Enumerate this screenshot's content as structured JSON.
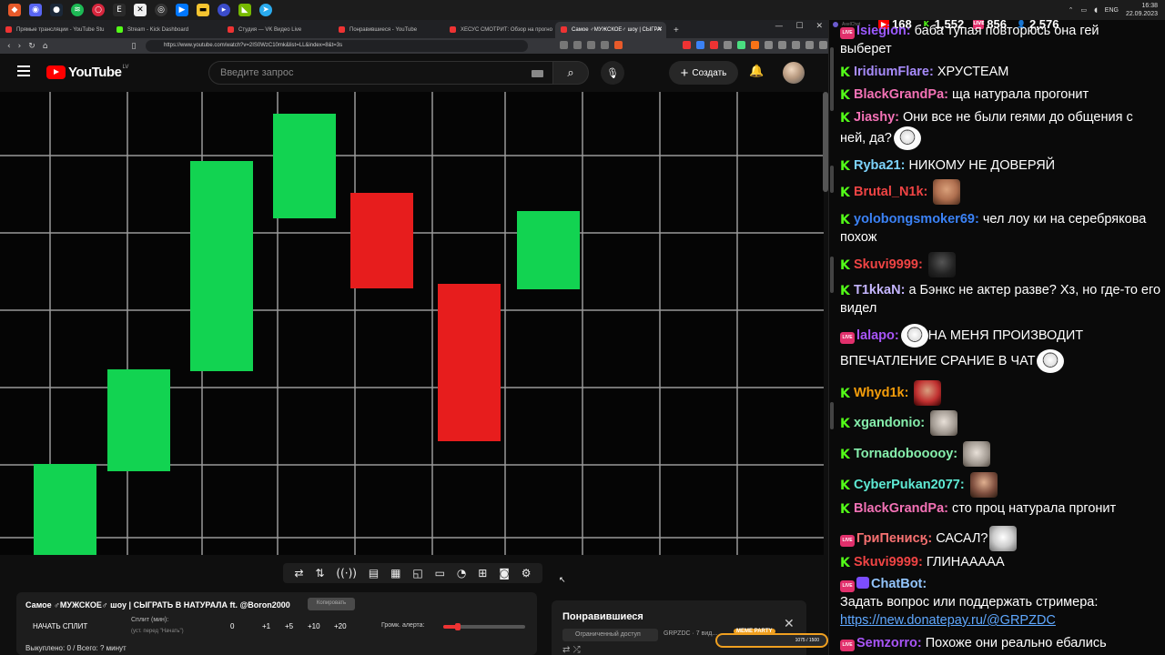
{
  "taskbar": {
    "icons": [
      "brave",
      "discord",
      "steam",
      "spotify",
      "opera-gx",
      "epic",
      "app-x",
      "obs",
      "vk",
      "folder",
      "youtube-music",
      "nvidia",
      "telegram"
    ],
    "tray_lang": "ENG",
    "clock_time": "16:38",
    "clock_date": "22.09.2023"
  },
  "browser": {
    "tabs": [
      {
        "label": "Прямые трансляции - YouTube Stu",
        "active": false
      },
      {
        "label": "Stream - Kick Dashboard",
        "active": false
      },
      {
        "label": "Студия — VK Видео Live",
        "active": false
      },
      {
        "label": "Понравившиеся - YouTube",
        "active": false
      },
      {
        "label": "ХЕСУС СМОТРИТ: Обзор на прогно",
        "active": false
      },
      {
        "label": "Самое ♂МУЖСКОЕ♂ шоу | СЫГРА",
        "active": true
      }
    ],
    "new_tab": "+",
    "url": "https://www.youtube.com/watch?v=2IS0WzC10mk&list=LL&index=8&t=3s"
  },
  "youtube": {
    "logo_text": "YouTube",
    "country": "LV",
    "search_placeholder": "Введите запрос",
    "create_label": "Создать"
  },
  "chart_data": {
    "type": "candlestick",
    "title": "",
    "xlabel": "",
    "ylabel": "",
    "bars": [
      {
        "open": 0,
        "close": 100,
        "direction": "up"
      },
      {
        "open": 92,
        "close": 204,
        "direction": "up"
      },
      {
        "open": 202,
        "close": 433,
        "direction": "up"
      },
      {
        "open": 370,
        "close": 485,
        "direction": "up"
      },
      {
        "open": 398,
        "close": 293,
        "direction": "down"
      },
      {
        "open": 298,
        "close": 125,
        "direction": "down"
      },
      {
        "open": 292,
        "close": 378,
        "direction": "up"
      }
    ],
    "ylim": [
      0,
      509
    ],
    "grid": true,
    "colors": {
      "up": "#12d351",
      "down": "#e71d1d",
      "grid": "#9a9a9a",
      "background": "#050505"
    }
  },
  "player_controls": [
    "loop-icon",
    "sort-icon",
    "broadcast-icon",
    "cc-icon",
    "chapters-icon",
    "miniplayer-icon",
    "theater-icon",
    "speed-icon",
    "cast-icon",
    "screenshot-icon",
    "settings-icon"
  ],
  "split_panel": {
    "title": "Самое ♂МУЖСКОЕ♂ шоу | СЫГРАТЬ В НАТУРАЛА ft. @Boron2000",
    "copy_label": "Копировать",
    "start_label": "НАЧАТЬ СПЛИТ",
    "split_label": "Сплит (мин):",
    "split_hint": "(уст. перед \"Начать\")",
    "split_value": "0",
    "increments": [
      "+1",
      "+5",
      "+10",
      "+20"
    ],
    "volume_label": "Громк. алерта:",
    "volume_level": 0.18,
    "status": "Выкуплено: 0 / Всего: ? минут"
  },
  "liked_panel": {
    "title": "Понравившиеся",
    "access": "Ограниченный доступ",
    "channel": "GRPZDC · 7 вид..."
  },
  "meme_party": {
    "label": "MEME PARTY",
    "count": "1075 / 1500"
  },
  "chat": {
    "app_label": "AxelChat",
    "stats": {
      "youtube_viewers": "168",
      "kick_viewers": "1,552",
      "vk_viewers": "856",
      "total_viewers": "2,576"
    },
    "messages": [
      {
        "platform": "vk",
        "nick": "Isiegion:",
        "text": "баба тупая повторюсь она гей",
        "nick_color": "#9b59ff"
      },
      {
        "platform": "",
        "nick": "",
        "text": "выберет",
        "nick_color": ""
      },
      {
        "platform": "kick",
        "nick": "IridiumFlare:",
        "text": "ХРУСТЕАМ",
        "nick_color": "#a78bfa"
      },
      {
        "platform": "kick",
        "nick": "BlackGrandPa:",
        "text": "ща натурала прогонит",
        "nick_color": "#f472b6"
      },
      {
        "platform": "kick",
        "nick": "Jiashy:",
        "text": "Они все не были геями до общения с ней, да?",
        "nick_color": "#f472b6",
        "emote": "joker"
      },
      {
        "platform": "kick",
        "nick": "Ryba21:",
        "text": "НИКОМУ НЕ ДОВЕРЯЙ",
        "nick_color": "#7dd3fc"
      },
      {
        "platform": "kick",
        "nick": "Brutal_N1k:",
        "text": "",
        "nick_color": "#ef4444",
        "emote": "face"
      },
      {
        "platform": "kick",
        "nick": "yolobongsmoker69:",
        "text": "чел лоу ки на серебрякова похож",
        "nick_color": "#3b82f6"
      },
      {
        "platform": "kick",
        "nick": "Skuvi9999:",
        "text": "",
        "nick_color": "#ef4444",
        "emote": "dark"
      },
      {
        "platform": "kick",
        "nick": "T1kkaN:",
        "text": "а Бэнкс не актер разве? Хз, но где-то его видел",
        "nick_color": "#c4b5fd"
      },
      {
        "platform": "vk",
        "nick": "lalapo:",
        "text": "НА МЕНЯ ПРОИЗВОДИТ ВПЕЧАТЛЕНИЕ СРАНИЕ В ЧАТ",
        "nick_color": "#a855f7",
        "emote": "joker"
      },
      {
        "platform": "kick",
        "nick": "Whyd1k:",
        "text": "",
        "nick_color": "#f59e0b",
        "emote": "red"
      },
      {
        "platform": "kick",
        "nick": "xgandonio:",
        "text": "",
        "nick_color": "#86efac",
        "emote": "cat"
      },
      {
        "platform": "kick",
        "nick": "Tornadobooooy:",
        "text": "",
        "nick_color": "#86efac",
        "emote": "cat"
      },
      {
        "platform": "kick",
        "nick": "CyberPukan2077:",
        "text": "",
        "nick_color": "#5eead4",
        "emote": "man"
      },
      {
        "platform": "kick",
        "nick": "BlackGrandPa:",
        "text": "сто проц натурала пргонит",
        "nick_color": "#f472b6"
      },
      {
        "platform": "vk",
        "nick": "ГриПенисӄ:",
        "text": "САСАЛ?",
        "nick_color": "#f87171",
        "emote": "bird"
      },
      {
        "platform": "kick",
        "nick": "Skuvi9999:",
        "text": "ГЛИНАААAA",
        "nick_color": "#ef4444"
      },
      {
        "platform": "vk",
        "nick": "ChatBot:",
        "text": "Задать вопрос или поддержать стримера:",
        "nick_color": "#93c5fd",
        "link": "https://new.donatepay.ru/@GRPZDC"
      },
      {
        "platform": "vk",
        "nick": "Semzorro:",
        "text": "Похоже они реально ебались",
        "nick_color": "#a855f7"
      }
    ]
  }
}
